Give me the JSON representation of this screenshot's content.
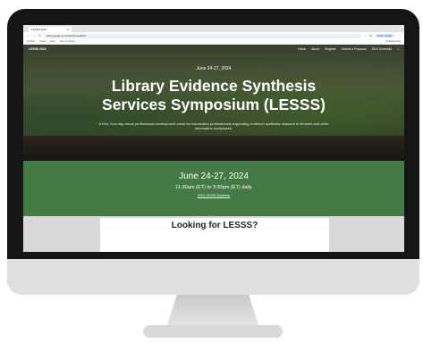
{
  "browser": {
    "tab_title": "LESSS 2024",
    "url": "sites.google.com/view/lesss2024",
    "profile_label": "Finish update",
    "bookmarks": [
      "All Tabs",
      "Gmail",
      "Apps",
      "Docs & Sheets"
    ],
    "bookmarks_right": "All Bookmarks"
  },
  "site": {
    "brand": "LESSS 2024",
    "nav": [
      "Home",
      "About",
      "Register",
      "Submit a Proposal",
      "2024 Schedule"
    ],
    "hero": {
      "date": "June 24-27, 2024",
      "title_line1": "Library Evidence Synthesis",
      "title_line2": "Services Symposium (LESSS)",
      "description": "A free, four-day virtual professional development event for information professionals supporting evidence synthesis research in libraries and other information workplaces."
    },
    "banner": {
      "date": "June 24-27, 2024",
      "time": "11:30am (ET) to 3:30pm (ET) daily",
      "link": "2024 LESSS Schedule"
    },
    "card": {
      "title": "Looking for LESSS?"
    }
  },
  "colors": {
    "banner_green": "#447a45",
    "bezel": "#151515"
  }
}
